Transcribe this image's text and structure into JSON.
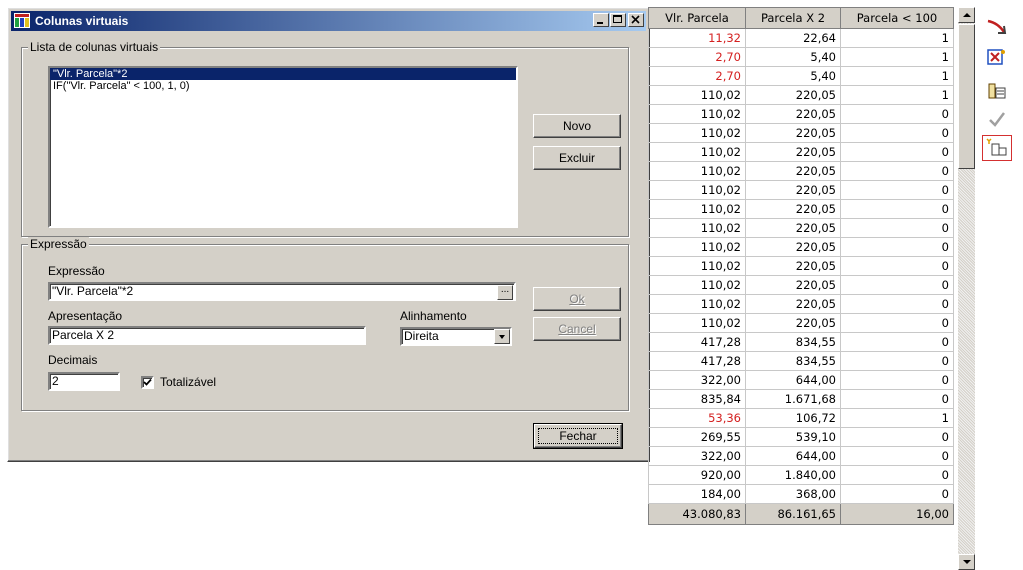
{
  "dialog": {
    "title": "Colunas virtuais",
    "list_group_label": "Lista de colunas virtuais",
    "list_items": [
      "\"Vlr. Parcela\"*2",
      "IF(\"Vlr. Parcela\" < 100, 1, 0)"
    ],
    "new_button": "Novo",
    "delete_button": "Excluir",
    "expr_group_label": "Expressão",
    "expression_label": "Expressão",
    "expression_value": "\"Vlr. Parcela\"*2",
    "ellipsis_label": "...",
    "ok_button": "Ok",
    "cancel_button": "Cancel",
    "presentation_label": "Apresentação",
    "presentation_value": "Parcela X 2",
    "alignment_label": "Alinhamento",
    "alignment_value": "Direita",
    "decimals_label": "Decimais",
    "decimals_value": "2",
    "totalizable_label": "Totalizável",
    "totalizable_checked": true,
    "close_button": "Fechar"
  },
  "grid": {
    "headers": [
      "Vlr. Parcela",
      "Parcela X 2",
      "Parcela < 100"
    ],
    "rows": [
      {
        "v": "11,32",
        "x2": "22,64",
        "lt": "1",
        "red": true
      },
      {
        "v": "2,70",
        "x2": "5,40",
        "lt": "1",
        "red": true
      },
      {
        "v": "2,70",
        "x2": "5,40",
        "lt": "1",
        "red": true
      },
      {
        "v": "110,02",
        "x2": "220,05",
        "lt": "1",
        "red": false
      },
      {
        "v": "110,02",
        "x2": "220,05",
        "lt": "0",
        "red": false
      },
      {
        "v": "110,02",
        "x2": "220,05",
        "lt": "0",
        "red": false
      },
      {
        "v": "110,02",
        "x2": "220,05",
        "lt": "0",
        "red": false
      },
      {
        "v": "110,02",
        "x2": "220,05",
        "lt": "0",
        "red": false
      },
      {
        "v": "110,02",
        "x2": "220,05",
        "lt": "0",
        "red": false
      },
      {
        "v": "110,02",
        "x2": "220,05",
        "lt": "0",
        "red": false
      },
      {
        "v": "110,02",
        "x2": "220,05",
        "lt": "0",
        "red": false
      },
      {
        "v": "110,02",
        "x2": "220,05",
        "lt": "0",
        "red": false
      },
      {
        "v": "110,02",
        "x2": "220,05",
        "lt": "0",
        "red": false
      },
      {
        "v": "110,02",
        "x2": "220,05",
        "lt": "0",
        "red": false
      },
      {
        "v": "110,02",
        "x2": "220,05",
        "lt": "0",
        "red": false
      },
      {
        "v": "110,02",
        "x2": "220,05",
        "lt": "0",
        "red": false
      },
      {
        "v": "417,28",
        "x2": "834,55",
        "lt": "0",
        "red": false
      },
      {
        "v": "417,28",
        "x2": "834,55",
        "lt": "0",
        "red": false
      },
      {
        "v": "322,00",
        "x2": "644,00",
        "lt": "0",
        "red": false
      },
      {
        "v": "835,84",
        "x2": "1.671,68",
        "lt": "0",
        "red": false
      },
      {
        "v": "53,36",
        "x2": "106,72",
        "lt": "1",
        "red": true
      },
      {
        "v": "269,55",
        "x2": "539,10",
        "lt": "0",
        "red": false
      },
      {
        "v": "322,00",
        "x2": "644,00",
        "lt": "0",
        "red": false
      },
      {
        "v": "920,00",
        "x2": "1.840,00",
        "lt": "0",
        "red": false
      },
      {
        "v": "184,00",
        "x2": "368,00",
        "lt": "0",
        "red": false
      }
    ],
    "totals": [
      "43.080,83",
      "86.161,65",
      "16,00"
    ]
  },
  "colors": {
    "titlebar": "#0a246a",
    "selection": "#0a246a",
    "negative_value": "#d42020",
    "window_face": "#d4d0c8"
  },
  "toolbar_icons": [
    "exit-arrow-icon",
    "virtual-columns-icon",
    "filter-columns-icon",
    "check-icon",
    "add-column-icon"
  ]
}
